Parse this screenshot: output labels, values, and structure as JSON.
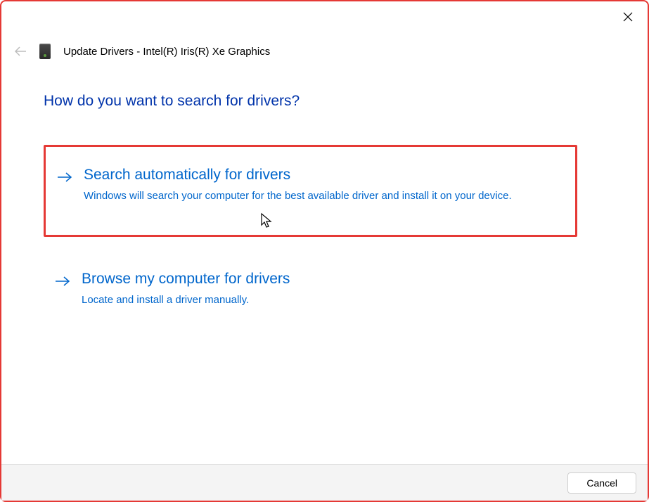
{
  "window": {
    "title": "Update Drivers - Intel(R) Iris(R) Xe Graphics"
  },
  "heading": "How do you want to search for drivers?",
  "options": [
    {
      "title": "Search automatically for drivers",
      "description": "Windows will search your computer for the best available driver and install it on your device."
    },
    {
      "title": "Browse my computer for drivers",
      "description": "Locate and install a driver manually."
    }
  ],
  "footer": {
    "cancel_label": "Cancel"
  }
}
